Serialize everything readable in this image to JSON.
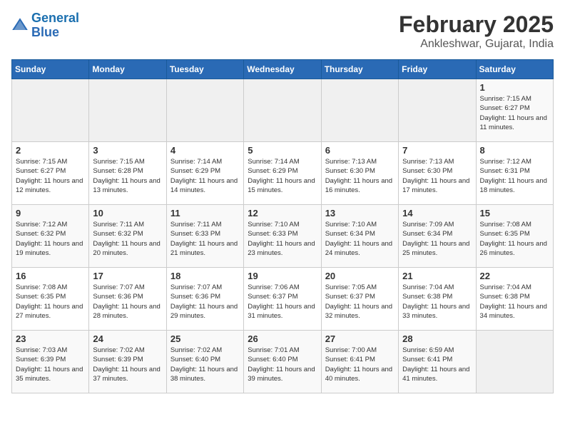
{
  "header": {
    "logo_line1": "General",
    "logo_line2": "Blue",
    "month": "February 2025",
    "location": "Ankleshwar, Gujarat, India"
  },
  "days_of_week": [
    "Sunday",
    "Monday",
    "Tuesday",
    "Wednesday",
    "Thursday",
    "Friday",
    "Saturday"
  ],
  "weeks": [
    [
      {
        "day": "",
        "info": ""
      },
      {
        "day": "",
        "info": ""
      },
      {
        "day": "",
        "info": ""
      },
      {
        "day": "",
        "info": ""
      },
      {
        "day": "",
        "info": ""
      },
      {
        "day": "",
        "info": ""
      },
      {
        "day": "1",
        "info": "Sunrise: 7:15 AM\nSunset: 6:27 PM\nDaylight: 11 hours and 11 minutes."
      }
    ],
    [
      {
        "day": "2",
        "info": "Sunrise: 7:15 AM\nSunset: 6:27 PM\nDaylight: 11 hours and 12 minutes."
      },
      {
        "day": "3",
        "info": "Sunrise: 7:15 AM\nSunset: 6:28 PM\nDaylight: 11 hours and 13 minutes."
      },
      {
        "day": "4",
        "info": "Sunrise: 7:14 AM\nSunset: 6:29 PM\nDaylight: 11 hours and 14 minutes."
      },
      {
        "day": "5",
        "info": "Sunrise: 7:14 AM\nSunset: 6:29 PM\nDaylight: 11 hours and 15 minutes."
      },
      {
        "day": "6",
        "info": "Sunrise: 7:13 AM\nSunset: 6:30 PM\nDaylight: 11 hours and 16 minutes."
      },
      {
        "day": "7",
        "info": "Sunrise: 7:13 AM\nSunset: 6:30 PM\nDaylight: 11 hours and 17 minutes."
      },
      {
        "day": "8",
        "info": "Sunrise: 7:12 AM\nSunset: 6:31 PM\nDaylight: 11 hours and 18 minutes."
      }
    ],
    [
      {
        "day": "9",
        "info": "Sunrise: 7:12 AM\nSunset: 6:32 PM\nDaylight: 11 hours and 19 minutes."
      },
      {
        "day": "10",
        "info": "Sunrise: 7:11 AM\nSunset: 6:32 PM\nDaylight: 11 hours and 20 minutes."
      },
      {
        "day": "11",
        "info": "Sunrise: 7:11 AM\nSunset: 6:33 PM\nDaylight: 11 hours and 21 minutes."
      },
      {
        "day": "12",
        "info": "Sunrise: 7:10 AM\nSunset: 6:33 PM\nDaylight: 11 hours and 23 minutes."
      },
      {
        "day": "13",
        "info": "Sunrise: 7:10 AM\nSunset: 6:34 PM\nDaylight: 11 hours and 24 minutes."
      },
      {
        "day": "14",
        "info": "Sunrise: 7:09 AM\nSunset: 6:34 PM\nDaylight: 11 hours and 25 minutes."
      },
      {
        "day": "15",
        "info": "Sunrise: 7:08 AM\nSunset: 6:35 PM\nDaylight: 11 hours and 26 minutes."
      }
    ],
    [
      {
        "day": "16",
        "info": "Sunrise: 7:08 AM\nSunset: 6:35 PM\nDaylight: 11 hours and 27 minutes."
      },
      {
        "day": "17",
        "info": "Sunrise: 7:07 AM\nSunset: 6:36 PM\nDaylight: 11 hours and 28 minutes."
      },
      {
        "day": "18",
        "info": "Sunrise: 7:07 AM\nSunset: 6:36 PM\nDaylight: 11 hours and 29 minutes."
      },
      {
        "day": "19",
        "info": "Sunrise: 7:06 AM\nSunset: 6:37 PM\nDaylight: 11 hours and 31 minutes."
      },
      {
        "day": "20",
        "info": "Sunrise: 7:05 AM\nSunset: 6:37 PM\nDaylight: 11 hours and 32 minutes."
      },
      {
        "day": "21",
        "info": "Sunrise: 7:04 AM\nSunset: 6:38 PM\nDaylight: 11 hours and 33 minutes."
      },
      {
        "day": "22",
        "info": "Sunrise: 7:04 AM\nSunset: 6:38 PM\nDaylight: 11 hours and 34 minutes."
      }
    ],
    [
      {
        "day": "23",
        "info": "Sunrise: 7:03 AM\nSunset: 6:39 PM\nDaylight: 11 hours and 35 minutes."
      },
      {
        "day": "24",
        "info": "Sunrise: 7:02 AM\nSunset: 6:39 PM\nDaylight: 11 hours and 37 minutes."
      },
      {
        "day": "25",
        "info": "Sunrise: 7:02 AM\nSunset: 6:40 PM\nDaylight: 11 hours and 38 minutes."
      },
      {
        "day": "26",
        "info": "Sunrise: 7:01 AM\nSunset: 6:40 PM\nDaylight: 11 hours and 39 minutes."
      },
      {
        "day": "27",
        "info": "Sunrise: 7:00 AM\nSunset: 6:41 PM\nDaylight: 11 hours and 40 minutes."
      },
      {
        "day": "28",
        "info": "Sunrise: 6:59 AM\nSunset: 6:41 PM\nDaylight: 11 hours and 41 minutes."
      },
      {
        "day": "",
        "info": ""
      }
    ]
  ]
}
